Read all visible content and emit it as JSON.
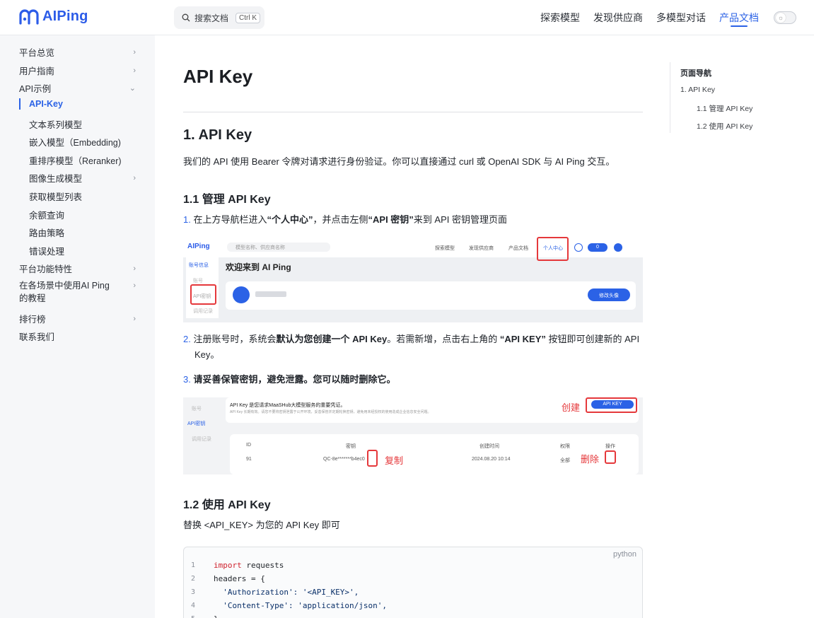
{
  "brand": {
    "name": "AIPing",
    "color": "#2c5ce8"
  },
  "search": {
    "label": "搜索文档",
    "shortcut": "Ctrl K"
  },
  "nav": [
    {
      "label": "探索模型"
    },
    {
      "label": "发现供应商"
    },
    {
      "label": "多模型对话"
    },
    {
      "label": "产品文档",
      "active": true
    }
  ],
  "sidebar": {
    "items": [
      {
        "label": "平台总览",
        "chevron": "right"
      },
      {
        "label": "用户指南",
        "chevron": "right"
      },
      {
        "label": "API示例",
        "chevron": "down"
      },
      {
        "label": "API-Key",
        "active": true
      },
      {
        "label": "文本系列模型"
      },
      {
        "label": "嵌入模型（Embedding)"
      },
      {
        "label": "重排序模型（Reranker)"
      },
      {
        "label": "图像生成模型",
        "chevron": "right"
      },
      {
        "label": "获取模型列表"
      },
      {
        "label": "余额查询"
      },
      {
        "label": "路由策略"
      },
      {
        "label": "错误处理"
      },
      {
        "label": "平台功能特性",
        "chevron": "right"
      },
      {
        "label": "在各场景中使用AI Ping的教程",
        "chevron": "right"
      },
      {
        "label": "排行榜",
        "chevron": "right"
      },
      {
        "label": "联系我们"
      }
    ]
  },
  "article": {
    "title": "API Key",
    "h2": "1. API Key",
    "intro": "我们的 API 使用 Bearer 令牌对请求进行身份验证。你可以直接通过 curl 或 OpenAI SDK 与 AI Ping 交互。",
    "h3_manage": "1.1 管理 API Key",
    "step1": {
      "num": "1.",
      "pre": "在上方导航栏进入",
      "bold1": "“个人中心”",
      "mid": "，并点击左侧",
      "bold2": "“API 密钥”",
      "post": "来到 API 密钥管理页面"
    },
    "step2": {
      "num": "2.",
      "pre": "注册账号时，系统会",
      "bold1": "默认为您创建一个 API Key",
      "mid": "。若需新增，点击右上角的 ",
      "bold2": "“API KEY”",
      "post": " 按钮即可创建新的 API",
      "post2": "Key。"
    },
    "step3": {
      "num": "3.",
      "text": "请妥善保管密钥，避免泄露。您可以随时删除它。"
    },
    "h3_use": "1.2 使用 API Key",
    "use_text": "替换 <API_KEY> 为您的 API Key 即可"
  },
  "shot1": {
    "logo": "AIPing",
    "search_placeholder": "模型名称、供应商名称",
    "nav": [
      "探索模型",
      "发现供应商",
      "产品文档",
      "个人中心"
    ],
    "balance": "0",
    "side_top": "账号信息",
    "side_items": [
      "账号",
      "API密钥",
      "调用记录"
    ],
    "welcome": "欢迎来到 AI Ping",
    "button": "修改头像"
  },
  "shot2": {
    "notice": "API Key 是您请求MaaSHub大模型服务的重要凭证。",
    "notice_sub": "API Key 长期有效。请您不要将密钥泄露于公开环境，妥善保管并定期轮换密钥，避免用未经授权的使用造成企业信息安全问题。",
    "side_items": [
      "账号",
      "API密钥",
      "调用记录"
    ],
    "button": "API KEY",
    "columns": [
      "ID",
      "密钥",
      "创建时间",
      "权限",
      "操作"
    ],
    "row": {
      "id": "91",
      "key": "QC-8e*******b4ec0",
      "time": "2024.08.20 10:14",
      "perm": "全部"
    },
    "annot_create": "创建",
    "annot_copy": "复制",
    "annot_delete": "删除"
  },
  "code": {
    "lang": "python",
    "lines": [
      {
        "n": "1",
        "kw": "import",
        "rest": " requests"
      },
      {
        "n": "2",
        "kw": "",
        "rest": "headers = {"
      },
      {
        "n": "3",
        "kw": "",
        "rest": "  'Authorization': '<API_KEY>',"
      },
      {
        "n": "4",
        "kw": "",
        "rest": "  'Content-Type': 'application/json',"
      },
      {
        "n": "5",
        "kw": "",
        "rest": "}"
      }
    ]
  },
  "toc": {
    "title": "页面导航",
    "items": [
      "1. API Key",
      "1.1 管理 API Key",
      "1.2 使用 API Key"
    ]
  }
}
